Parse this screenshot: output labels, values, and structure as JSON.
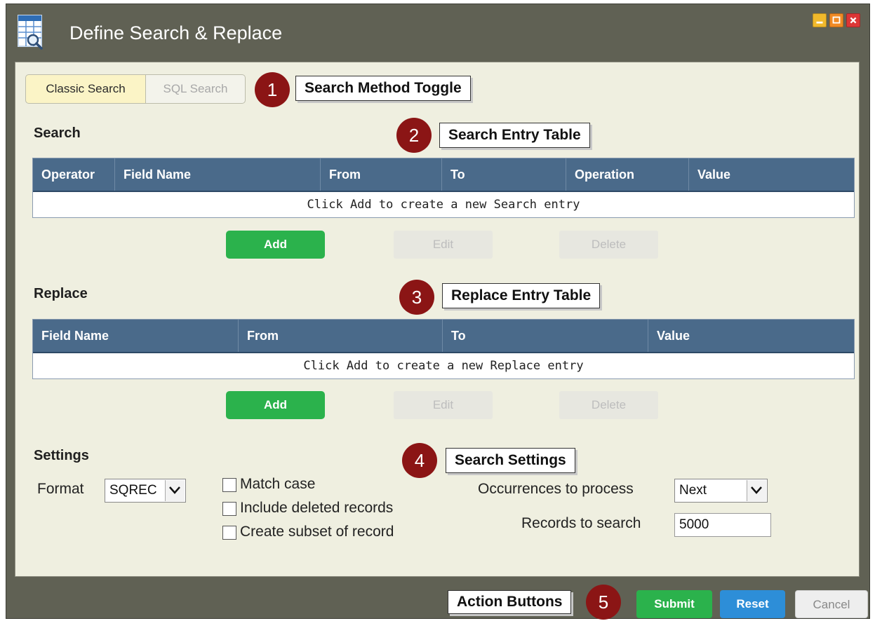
{
  "window": {
    "title": "Define Search & Replace"
  },
  "search_method": {
    "classic_label": "Classic Search",
    "sql_label": "SQL Search"
  },
  "callouts": {
    "c1": {
      "num": "1",
      "label": "Search Method Toggle"
    },
    "c2": {
      "num": "2",
      "label": "Search Entry Table"
    },
    "c3": {
      "num": "3",
      "label": "Replace Entry Table"
    },
    "c4": {
      "num": "4",
      "label": "Search Settings"
    },
    "c5": {
      "num": "5",
      "label": "Action Buttons"
    }
  },
  "search": {
    "title": "Search",
    "columns": [
      "Operator",
      "Field Name",
      "From",
      "To",
      "Operation",
      "Value"
    ],
    "empty_text": "Click Add to create a new Search entry",
    "add_label": "Add",
    "edit_label": "Edit",
    "delete_label": "Delete"
  },
  "replace": {
    "title": "Replace",
    "columns": [
      "Field Name",
      "From",
      "To",
      "Value"
    ],
    "empty_text": "Click Add to create a new Replace entry",
    "add_label": "Add",
    "edit_label": "Edit",
    "delete_label": "Delete"
  },
  "settings": {
    "title": "Settings",
    "format_label": "Format",
    "format_value": "SQREC",
    "match_case_label": "Match case",
    "include_deleted_label": "Include deleted records",
    "create_subset_label": "Create subset of record",
    "occurrences_label": "Occurrences to process",
    "occurrences_value": "Next",
    "records_label": "Records to search",
    "records_value": "5000"
  },
  "footer": {
    "submit_label": "Submit",
    "reset_label": "Reset",
    "cancel_label": "Cancel"
  },
  "colors": {
    "window_frame": "#606154",
    "content_bg": "#efefe0",
    "table_header": "#4a6a8a",
    "green": "#2bb24c",
    "blue": "#2d8ed8",
    "callout_red": "#8b1515"
  }
}
